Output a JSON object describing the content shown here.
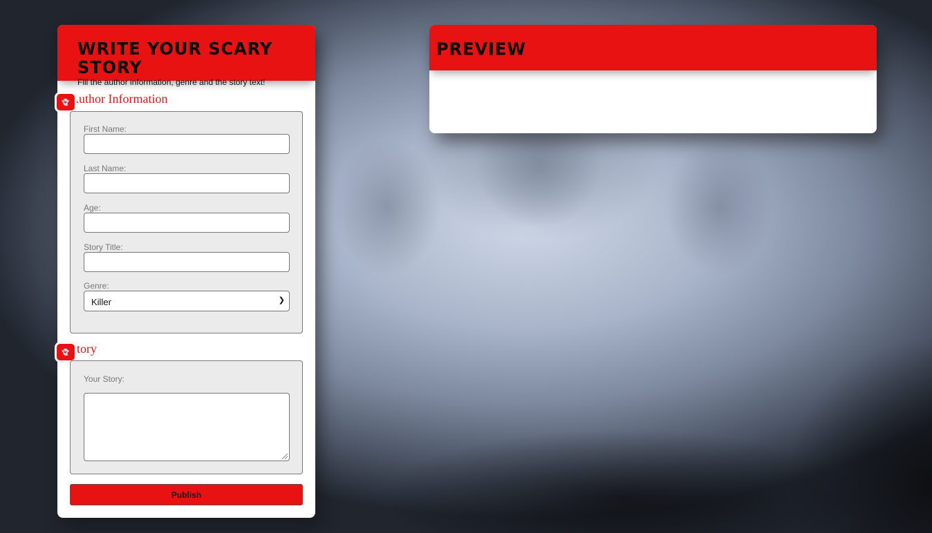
{
  "form": {
    "title": "Write your scary story",
    "subtitle": "Fill the author information, genre and the story text!",
    "author_section": {
      "title": "Author Information",
      "badge_icon": "ghost-icon",
      "fields": {
        "first_name_label": "First Name:",
        "first_name_value": "",
        "last_name_label": "Last Name:",
        "last_name_value": "",
        "age_label": "Age:",
        "age_value": "",
        "story_title_label": "Story Title:",
        "story_title_value": "",
        "genre_label": "Genre:",
        "genre_selected": "Killer"
      }
    },
    "story_section": {
      "title": "Story",
      "badge_icon": "ghost-icon",
      "story_label": "Your Story:",
      "story_value": ""
    },
    "publish_label": "Publish"
  },
  "preview": {
    "title": "Preview",
    "content": ""
  },
  "colors": {
    "accent": "#e81212",
    "section_title": "#d11a1a",
    "fieldset_bg": "#ebebeb"
  }
}
